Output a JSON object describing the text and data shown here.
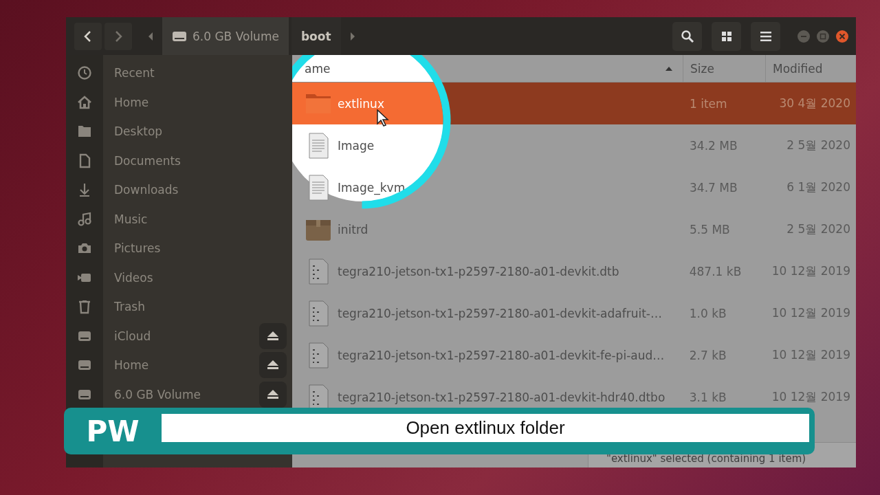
{
  "window": {
    "path": [
      {
        "label": "6.0 GB Volume",
        "selected": false
      },
      {
        "label": "boot",
        "selected": true
      }
    ]
  },
  "sidebar": {
    "items": [
      {
        "label": "Recent",
        "kind": "recent",
        "eject": false
      },
      {
        "label": "Home",
        "kind": "home",
        "eject": false
      },
      {
        "label": "Desktop",
        "kind": "folder",
        "eject": false
      },
      {
        "label": "Documents",
        "kind": "document",
        "eject": false
      },
      {
        "label": "Downloads",
        "kind": "download",
        "eject": false
      },
      {
        "label": "Music",
        "kind": "music",
        "eject": false
      },
      {
        "label": "Pictures",
        "kind": "camera",
        "eject": false
      },
      {
        "label": "Videos",
        "kind": "video",
        "eject": false
      },
      {
        "label": "Trash",
        "kind": "trash",
        "eject": false
      },
      {
        "label": "iCloud",
        "kind": "drive",
        "eject": true
      },
      {
        "label": "Home",
        "kind": "drive",
        "eject": true
      },
      {
        "label": "6.0 GB Volume",
        "kind": "drive",
        "eject": true
      }
    ]
  },
  "file_list": {
    "columns": [
      {
        "label": "ame",
        "sorted": true
      },
      {
        "label": "Size",
        "sorted": false
      },
      {
        "label": "Modified",
        "sorted": false
      }
    ],
    "rows": [
      {
        "name": "extlinux",
        "size": "1 item",
        "modified": "30 4월 2020",
        "kind": "folder",
        "selected": true
      },
      {
        "name": "Image",
        "size": "34.2 MB",
        "modified": "2 5월 2020",
        "kind": "document",
        "selected": false
      },
      {
        "name": "Image_kvm",
        "size": "34.7 MB",
        "modified": "6 1월 2020",
        "kind": "document",
        "selected": false
      },
      {
        "name": "initrd",
        "size": "5.5 MB",
        "modified": "2 5월 2020",
        "kind": "archive",
        "selected": false
      },
      {
        "name": "tegra210-jetson-tx1-p2597-2180-a01-devkit.dtb",
        "size": "487.1 kB",
        "modified": "10 12월 2019",
        "kind": "binary",
        "selected": false
      },
      {
        "name": "tegra210-jetson-tx1-p2597-2180-a01-devkit-adafruit-…",
        "size": "1.0 kB",
        "modified": "10 12월 2019",
        "kind": "binary",
        "selected": false
      },
      {
        "name": "tegra210-jetson-tx1-p2597-2180-a01-devkit-fe-pi-aud…",
        "size": "2.7 kB",
        "modified": "10 12월 2019",
        "kind": "binary",
        "selected": false
      },
      {
        "name": "tegra210-jetson-tx1-p2597-2180-a01-devkit-hdr40.dtbo",
        "size": "3.1 kB",
        "modified": "10 12월 2019",
        "kind": "binary",
        "selected": false
      }
    ]
  },
  "status_bar": {
    "text": "\"extlinux\" selected (containing 1 item)"
  },
  "caption": {
    "logo": "PW",
    "text": "Open extlinux folder"
  }
}
